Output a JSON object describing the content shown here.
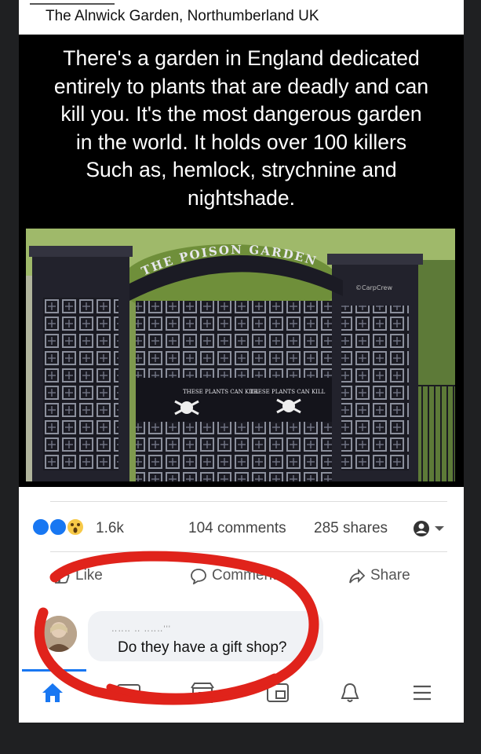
{
  "caption": "The Alnwick Garden, Northumberland UK",
  "meme_lines": [
    "There's a garden in England dedicated",
    "entirely to plants that are deadly and can",
    "kill you. It's the most dangerous garden",
    "in the world. It holds over 100 killers",
    "Such as, hemlock, strychnine and",
    "nightshade."
  ],
  "photo": {
    "arch_text": "THE POISON GARDEN",
    "gate_signs": [
      "THESE PLANTS CAN KILL",
      "THESE PLANTS CAN KILL"
    ],
    "watermark": "©CarpCrew"
  },
  "post_stats": {
    "reactions_count": "1.6k",
    "comments": "104 comments",
    "shares": "285 shares"
  },
  "actions": {
    "like": "Like",
    "comment": "Comment",
    "share": "Share"
  },
  "comment": {
    "text": "Do they have a gift shop?"
  },
  "colors": {
    "fb_blue": "#1877f2",
    "annotation_red": "#e0231b",
    "frame_black": "#000000"
  },
  "nav": [
    "home-icon",
    "video-icon",
    "marketplace-icon",
    "groups-icon",
    "notifications-icon",
    "menu-icon"
  ]
}
